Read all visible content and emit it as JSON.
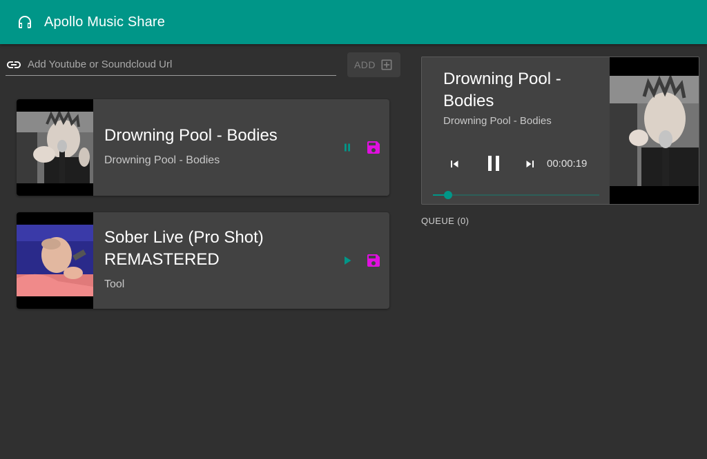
{
  "app": {
    "title": "Apollo Music Share",
    "logo_icon": "headphones-icon",
    "brand_color": "#009688"
  },
  "url_input": {
    "value": "",
    "placeholder": "Add Youtube or Soundcloud Url",
    "icon": "link-icon"
  },
  "add_button": {
    "label": "ADD",
    "icon": "add-box-icon"
  },
  "songs": [
    {
      "title": "Drowning Pool - Bodies",
      "artist": "Drowning Pool - Bodies",
      "state": "playing",
      "action_icon": "pause-icon",
      "save_icon": "save-icon"
    },
    {
      "title": "Sober Live (Pro Shot) REMASTERED",
      "artist": "Tool",
      "state": "paused",
      "action_icon": "play-icon",
      "save_icon": "save-icon"
    }
  ],
  "player": {
    "title": "Drowning Pool - Bodies",
    "subtitle": "Drowning Pool - Bodies",
    "time": "00:00:19",
    "progress": 0.09,
    "controls": [
      "skip-previous-icon",
      "pause-icon",
      "skip-next-icon"
    ]
  },
  "queue": {
    "label": "QUEUE (0)"
  },
  "colors": {
    "accent": "#009688",
    "save": "#e010e0",
    "card": "#424242",
    "background": "#303030"
  }
}
